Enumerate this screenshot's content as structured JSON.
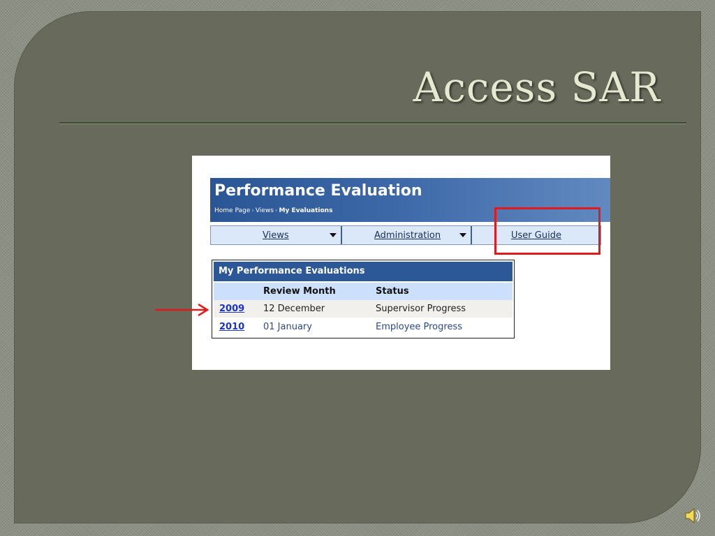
{
  "slide": {
    "title": "Access SAR"
  },
  "app": {
    "title": "Performance Evaluation",
    "breadcrumb": {
      "items": [
        "Home Page",
        "Views"
      ],
      "current": "My Evaluations"
    },
    "menu": {
      "views": "Views",
      "administration": "Administration",
      "user_guide": "User Guide"
    },
    "evaluations": {
      "title": "My Performance Evaluations",
      "headers": {
        "review_month": "Review Month",
        "status": "Status"
      },
      "rows": [
        {
          "year": "2009",
          "month": "12 December",
          "status": "Supervisor Progress"
        },
        {
          "year": "2010",
          "month": "01 January",
          "status": "Employee Progress"
        }
      ]
    }
  },
  "icons": {
    "arrow": "right-arrow-icon",
    "speaker": "speaker-icon",
    "caret": "caret-down-icon"
  },
  "colors": {
    "slide_bg": "#686b5b",
    "title": "#e6e8cf",
    "header_blue": "#2c5898",
    "highlight_red": "#e01b1b",
    "link_blue": "#1a33c8"
  }
}
